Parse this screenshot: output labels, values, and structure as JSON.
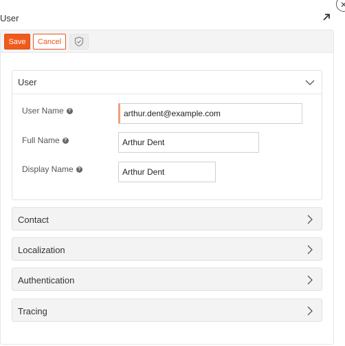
{
  "window": {
    "title": "User",
    "close_icon": "close-icon",
    "expand_icon": "expand-arrow-icon"
  },
  "toolbar": {
    "save_label": "Save",
    "cancel_label": "Cancel",
    "shield_icon": "shield-check-icon"
  },
  "sections": {
    "user": {
      "title": "User",
      "expanded": true,
      "fields": {
        "user_name": {
          "label": "User Name",
          "value": "arthur.dent@example.com",
          "required": true
        },
        "full_name": {
          "label": "Full Name",
          "value": "Arthur Dent"
        },
        "display_name": {
          "label": "Display Name",
          "value": "Arthur Dent"
        }
      }
    },
    "contact": {
      "title": "Contact",
      "expanded": false
    },
    "localization": {
      "title": "Localization",
      "expanded": false
    },
    "authentication": {
      "title": "Authentication",
      "expanded": false
    },
    "tracing": {
      "title": "Tracing",
      "expanded": false
    }
  },
  "colors": {
    "accent": "#f05a1a",
    "required_marker": "#f0a07a"
  }
}
